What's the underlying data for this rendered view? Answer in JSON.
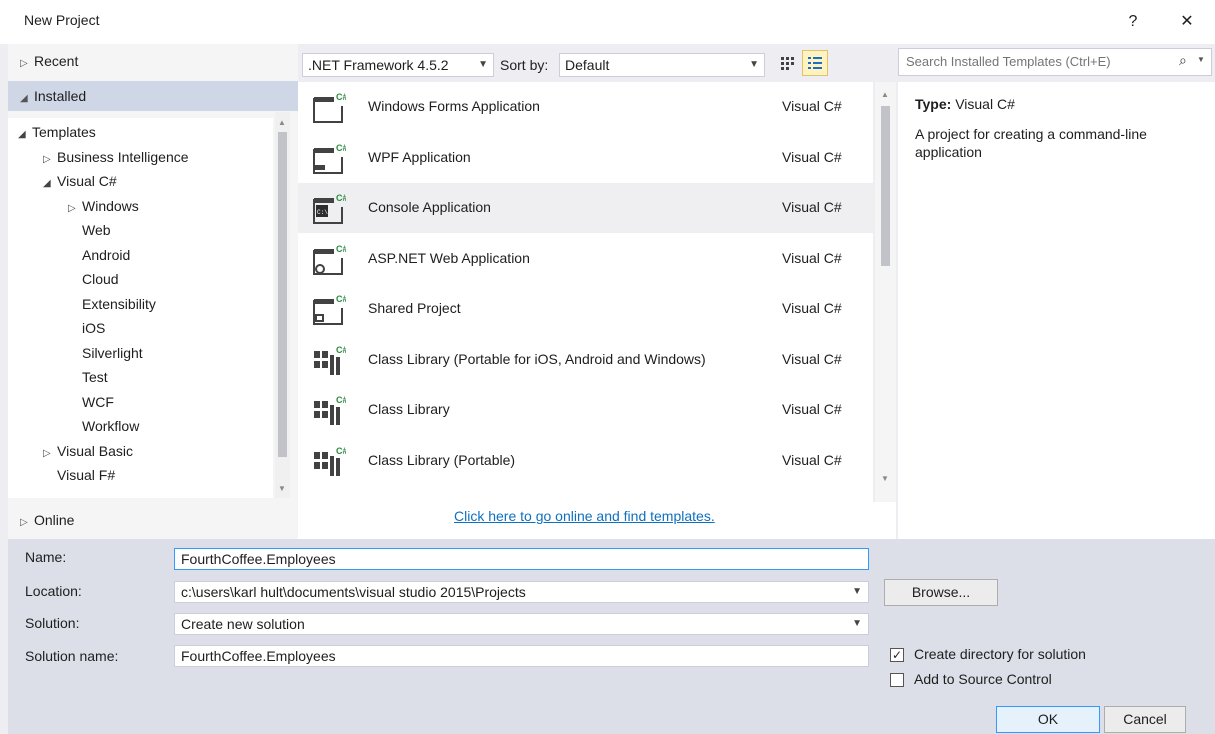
{
  "window": {
    "title": "New Project",
    "help_label": "?",
    "close_label": "✕"
  },
  "left": {
    "recent": "Recent",
    "installed": "Installed",
    "online": "Online",
    "tree": [
      {
        "label": "Templates",
        "arrow": "◢",
        "indent": 0
      },
      {
        "label": "Business Intelligence",
        "arrow": "▷",
        "indent": 1
      },
      {
        "label": "Visual C#",
        "arrow": "◢",
        "indent": 1
      },
      {
        "label": "Windows",
        "arrow": "▷",
        "indent": 2
      },
      {
        "label": "Web",
        "arrow": "",
        "indent": 2
      },
      {
        "label": "Android",
        "arrow": "",
        "indent": 2
      },
      {
        "label": "Cloud",
        "arrow": "",
        "indent": 2
      },
      {
        "label": "Extensibility",
        "arrow": "",
        "indent": 2
      },
      {
        "label": "iOS",
        "arrow": "",
        "indent": 2
      },
      {
        "label": "Silverlight",
        "arrow": "",
        "indent": 2
      },
      {
        "label": "Test",
        "arrow": "",
        "indent": 2
      },
      {
        "label": "WCF",
        "arrow": "",
        "indent": 2
      },
      {
        "label": "Workflow",
        "arrow": "",
        "indent": 2
      },
      {
        "label": "Visual Basic",
        "arrow": "▷",
        "indent": 1
      },
      {
        "label": "Visual F#",
        "arrow": "",
        "indent": 1
      }
    ]
  },
  "toolbar": {
    "framework": ".NET Framework 4.5.2",
    "sort_label": "Sort by:",
    "sort_value": "Default",
    "view_small_icons": "small-icons-view-icon",
    "view_list": "list-view-icon"
  },
  "templates": [
    {
      "name": "Windows Forms Application",
      "lang": "Visual C#",
      "icon": "window-csharp-icon",
      "selected": false
    },
    {
      "name": "WPF Application",
      "lang": "Visual C#",
      "icon": "wpf-csharp-icon",
      "selected": false
    },
    {
      "name": "Console Application",
      "lang": "Visual C#",
      "icon": "console-csharp-icon",
      "selected": true
    },
    {
      "name": "ASP.NET Web Application",
      "lang": "Visual C#",
      "icon": "web-csharp-icon",
      "selected": false
    },
    {
      "name": "Shared Project",
      "lang": "Visual C#",
      "icon": "shared-csharp-icon",
      "selected": false
    },
    {
      "name": "Class Library (Portable for iOS, Android and Windows)",
      "lang": "Visual C#",
      "icon": "library-csharp-icon",
      "selected": false
    },
    {
      "name": "Class Library",
      "lang": "Visual C#",
      "icon": "library-csharp-icon",
      "selected": false
    },
    {
      "name": "Class Library (Portable)",
      "lang": "Visual C#",
      "icon": "library-csharp-icon",
      "selected": false
    }
  ],
  "online_link": "Click here to go online and find templates.",
  "search": {
    "placeholder": "Search Installed Templates (Ctrl+E)"
  },
  "details": {
    "type_label": "Type:",
    "type_value": "Visual C#",
    "description": "A project for creating a command-line application"
  },
  "form": {
    "name_label": "Name:",
    "name_value": "FourthCoffee.Employees",
    "location_label": "Location:",
    "location_value": "c:\\users\\karl hult\\documents\\visual studio 2015\\Projects",
    "solution_label": "Solution:",
    "solution_value": "Create new solution",
    "solution_name_label": "Solution name:",
    "solution_name_value": "FourthCoffee.Employees",
    "browse_label": "Browse...",
    "create_dir_label": "Create directory for solution",
    "create_dir_checked": true,
    "source_control_label": "Add to Source Control",
    "source_control_checked": false,
    "ok_label": "OK",
    "cancel_label": "Cancel"
  }
}
